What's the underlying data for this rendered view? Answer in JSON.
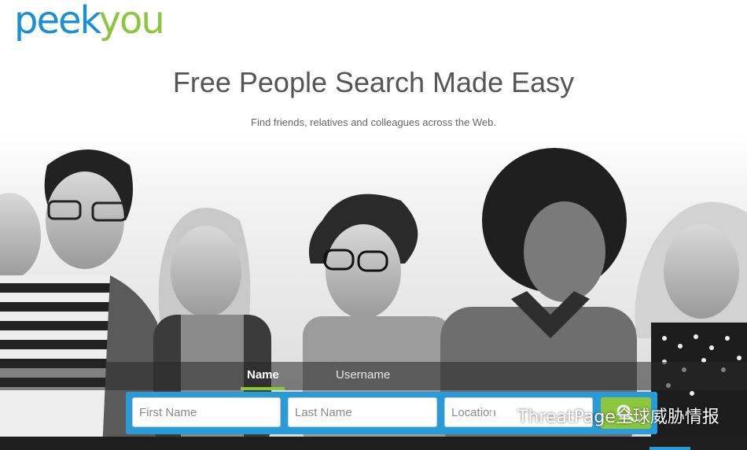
{
  "brand": {
    "logo_part1": "peek",
    "logo_part2": "you",
    "primary": "#1c8fd4",
    "accent": "#8cc63f"
  },
  "hero": {
    "headline": "Free People Search Made Easy",
    "subtitle": "Find friends, relatives and colleagues across the Web."
  },
  "search": {
    "tabs": [
      {
        "label": "Name",
        "active": true
      },
      {
        "label": "Username",
        "active": false
      }
    ],
    "first_name_placeholder": "First Name",
    "last_name_placeholder": "Last Name",
    "location_placeholder": "Location",
    "button_icon": "search-icon"
  },
  "watermark": {
    "text": "ThreatPage全球威胁情报",
    "icon": "wechat-icon"
  }
}
